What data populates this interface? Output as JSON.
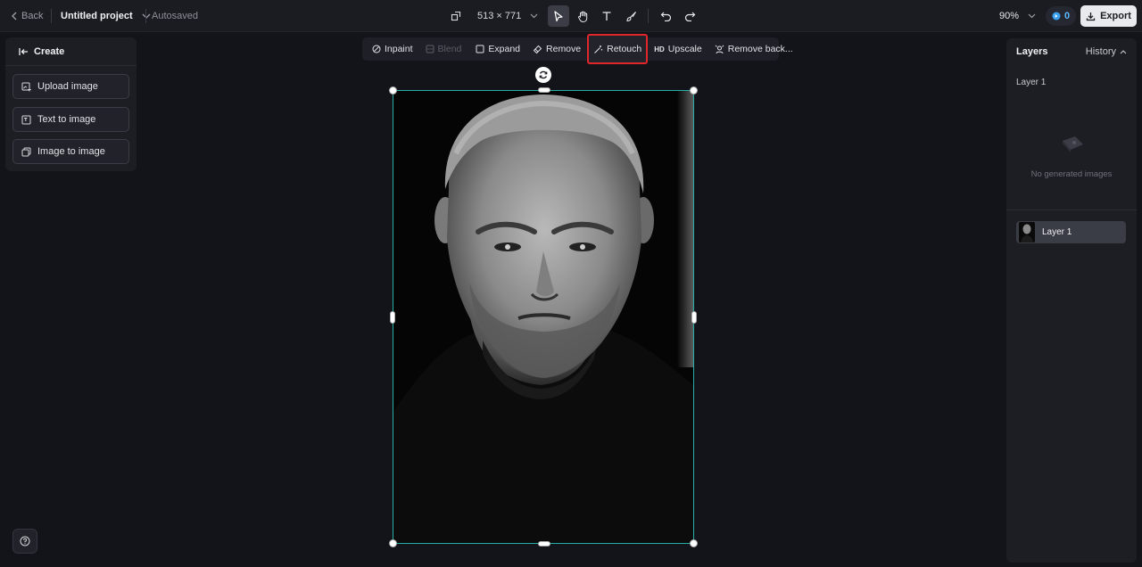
{
  "topbar": {
    "back_label": "Back",
    "project_name": "Untitled project",
    "save_status": "Autosaved",
    "canvas_size": "513 × 771",
    "zoom": "90%",
    "credits": "0",
    "export_label": "Export"
  },
  "tools": [
    "select",
    "hand",
    "text",
    "brush",
    "undo",
    "redo"
  ],
  "left_panel": {
    "title": "Create",
    "items": [
      {
        "label": "Upload image",
        "icon": "upload-image-icon"
      },
      {
        "label": "Text to image",
        "icon": "text-to-image-icon"
      },
      {
        "label": "Image to image",
        "icon": "image-to-image-icon"
      }
    ]
  },
  "edit_bar": {
    "items": [
      {
        "label": "Inpaint",
        "icon": "inpaint-icon",
        "state": "enabled"
      },
      {
        "label": "Blend",
        "icon": "blend-icon",
        "state": "disabled"
      },
      {
        "label": "Expand",
        "icon": "expand-icon",
        "state": "enabled"
      },
      {
        "label": "Remove",
        "icon": "eraser-icon",
        "state": "enabled"
      },
      {
        "label": "Retouch",
        "icon": "magic-wand-icon",
        "state": "highlighted"
      },
      {
        "label": "Upscale",
        "icon": "hd-icon",
        "state": "enabled"
      },
      {
        "label": "Remove back...",
        "icon": "remove-background-icon",
        "state": "enabled"
      }
    ]
  },
  "right_panel": {
    "title": "Layers",
    "history_label": "History",
    "section_label": "Layer 1",
    "empty_text": "No generated images",
    "layers": [
      {
        "label": "Layer 1"
      }
    ]
  },
  "colors": {
    "selection": "#27b0a8",
    "highlight": "#e0262b",
    "credits": "#5db8ff"
  }
}
